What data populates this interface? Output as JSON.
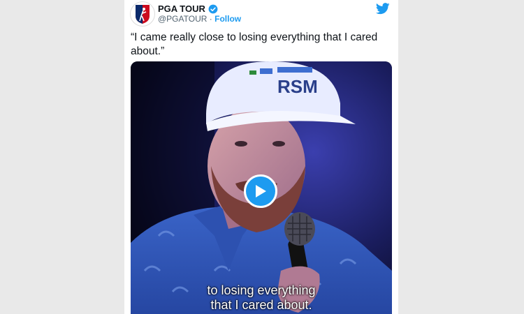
{
  "account": {
    "name": "PGA TOUR",
    "handle": "@PGATOUR",
    "separator": "·",
    "follow_label": "Follow",
    "verified": true
  },
  "tweet": {
    "text": "“I came really close to losing everything that I cared about.”"
  },
  "video": {
    "cap_logo": "RSM",
    "captions": [
      "to losing everything",
      "that I cared about."
    ],
    "play_icon": "play-icon"
  },
  "colors": {
    "accent": "#1d9bf0",
    "text": "#0f1419",
    "muted": "#536471"
  }
}
